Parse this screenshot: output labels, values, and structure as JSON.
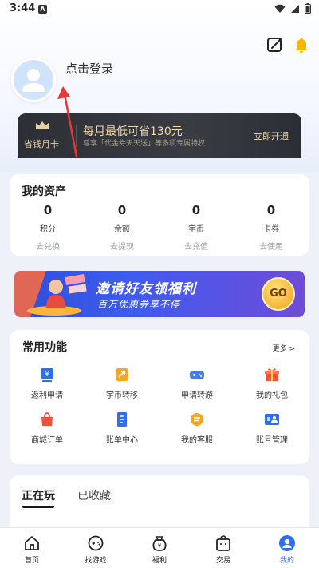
{
  "status_bar": {
    "time": "3:44",
    "badge": "A"
  },
  "header": {
    "login_text": "点击登录",
    "icons": [
      "edit-icon",
      "bell-icon"
    ]
  },
  "vip": {
    "name": "省钱月卡",
    "title": "每月最低可省130元",
    "subtitle": "尊享「代金券天天送」等多项专属特权",
    "open_label": "立即开通"
  },
  "assets": {
    "title": "我的资产",
    "items": [
      {
        "value": "0",
        "label": "积分",
        "action": "去兑换"
      },
      {
        "value": "0",
        "label": "余额",
        "action": "去提现"
      },
      {
        "value": "0",
        "label": "宇币",
        "action": "去充值"
      },
      {
        "value": "0",
        "label": "卡券",
        "action": "去使用"
      }
    ]
  },
  "banner": {
    "title": "邀请好友领福利",
    "subtitle": "百万优惠券享不停",
    "go_label": "GO"
  },
  "functions": {
    "title": "常用功能",
    "more_label": "更多 >",
    "items": [
      {
        "label": "返利申请",
        "icon": "rebate-icon",
        "color": "#2d6ff0"
      },
      {
        "label": "宇币转移",
        "icon": "transfer-icon",
        "color": "#f5a623"
      },
      {
        "label": "申请转游",
        "icon": "gamepad-icon",
        "color": "#4a7cf0"
      },
      {
        "label": "我的礼包",
        "icon": "gift-icon",
        "color": "#f0503c"
      },
      {
        "label": "商城订单",
        "icon": "shopping-bag-icon",
        "color": "#f0503c"
      },
      {
        "label": "账单中心",
        "icon": "bill-icon",
        "color": "#2d6ff0"
      },
      {
        "label": "我的客服",
        "icon": "chat-icon",
        "color": "#f5a623"
      },
      {
        "label": "账号管理",
        "icon": "account-icon",
        "color": "#2d6ff0"
      }
    ]
  },
  "games": {
    "tabs": [
      {
        "label": "正在玩",
        "active": true
      },
      {
        "label": "已收藏",
        "active": false
      }
    ]
  },
  "bottom_nav": {
    "items": [
      {
        "label": "首页",
        "icon": "home-icon",
        "active": false
      },
      {
        "label": "找游戏",
        "icon": "find-game-icon",
        "active": false
      },
      {
        "label": "福利",
        "icon": "welfare-icon",
        "active": false
      },
      {
        "label": "交易",
        "icon": "trade-icon",
        "active": false
      },
      {
        "label": "我的",
        "icon": "profile-icon",
        "active": true
      }
    ]
  },
  "colors": {
    "accent": "#2d6ff0",
    "vip_gold": "#f2d9a8",
    "annotation_arrow": "#e53935"
  }
}
